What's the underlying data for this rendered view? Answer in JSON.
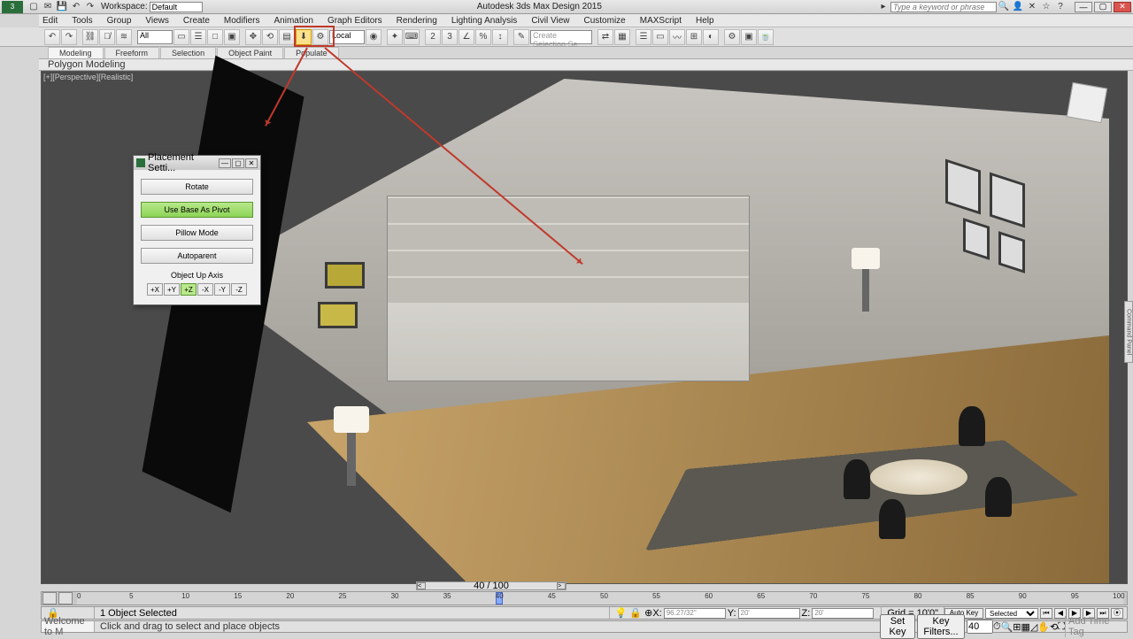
{
  "titlebar": {
    "workspace_label": "Workspace:",
    "workspace_value": "Default",
    "app_title": "Autodesk 3ds Max Design 2015",
    "search_placeholder": "Type a keyword or phrase"
  },
  "menus": [
    "Edit",
    "Tools",
    "Group",
    "Views",
    "Create",
    "Modifiers",
    "Animation",
    "Graph Editors",
    "Rendering",
    "Lighting Analysis",
    "Civil View",
    "Customize",
    "MAXScript",
    "Help"
  ],
  "toolbar": {
    "selset_placeholder": "Create Selection Se",
    "all_filter": "All",
    "coord_sys": "Local"
  },
  "ribbon": {
    "tabs": [
      "Modeling",
      "Freeform",
      "Selection",
      "Object Paint",
      "Populate"
    ],
    "active_tab": "Modeling",
    "panel_label": "Polygon Modeling"
  },
  "viewport": {
    "label": "[+][Perspective][Realistic]"
  },
  "dialog": {
    "title": "Placement Setti...",
    "buttons": {
      "rotate": "Rotate",
      "use_base": "Use Base As Pivot",
      "pillow": "Pillow Mode",
      "autoparent": "Autoparent"
    },
    "axis_label": "Object Up Axis",
    "axes": [
      "+X",
      "+Y",
      "+Z",
      "-X",
      "-Y",
      "-Z"
    ],
    "axis_selected": "+Z"
  },
  "timeline": {
    "slider_text": "40 / 100",
    "ticks": [
      "0",
      "5",
      "10",
      "15",
      "20",
      "25",
      "30",
      "35",
      "40",
      "45",
      "50",
      "55",
      "60",
      "65",
      "70",
      "75",
      "80",
      "85",
      "90",
      "95",
      "100"
    ]
  },
  "status": {
    "selection": "1 Object Selected",
    "x_label": "X:",
    "x_val": "96.27/32\"",
    "y_label": "Y:",
    "y_val": "20'",
    "z_label": "Z:",
    "z_val": "20'",
    "grid": "Grid = 10'0\"",
    "autokey": "Auto Key",
    "setkey": "Set Key",
    "selected_drop": "Selected",
    "keyfilters": "Key Filters...",
    "frame_val": "40"
  },
  "prompt": {
    "listener": "Welcome to M",
    "message": "Click and drag to select and place objects",
    "timetag": "Add Time Tag"
  },
  "cmdpanel": "Command Panel"
}
